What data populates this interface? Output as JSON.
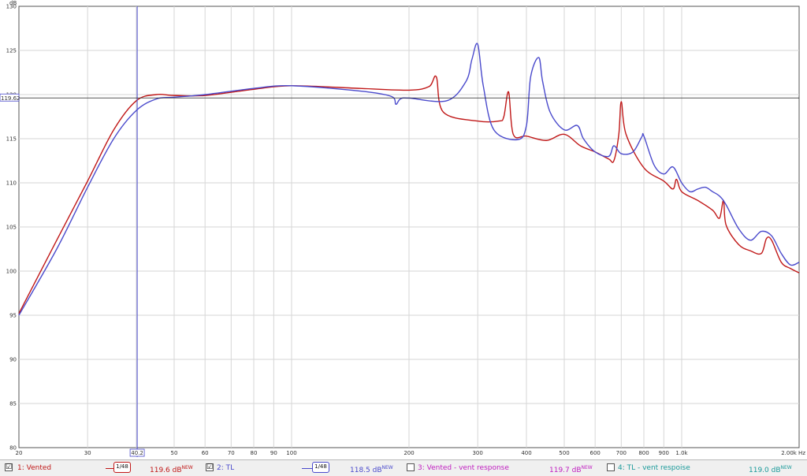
{
  "chart_data": {
    "type": "line",
    "title": "",
    "xlabel": "",
    "ylabel": "dB",
    "x_scale": "log",
    "xlim": [
      20,
      2000
    ],
    "ylim": [
      80,
      130
    ],
    "grid": true,
    "x_ticks": [
      {
        "v": 20,
        "label": "20"
      },
      {
        "v": 30,
        "label": "30"
      },
      {
        "v": 40,
        "label": ""
      },
      {
        "v": 50,
        "label": "50"
      },
      {
        "v": 60,
        "label": "60"
      },
      {
        "v": 70,
        "label": "70"
      },
      {
        "v": 80,
        "label": "80"
      },
      {
        "v": 90,
        "label": "90"
      },
      {
        "v": 100,
        "label": "100"
      },
      {
        "v": 200,
        "label": "200"
      },
      {
        "v": 300,
        "label": "300"
      },
      {
        "v": 400,
        "label": "400"
      },
      {
        "v": 500,
        "label": "500"
      },
      {
        "v": 600,
        "label": "600"
      },
      {
        "v": 700,
        "label": "700"
      },
      {
        "v": 800,
        "label": "800"
      },
      {
        "v": 900,
        "label": "900"
      },
      {
        "v": 1000,
        "label": "1.0k"
      },
      {
        "v": 2000,
        "label": "2.00k Hz"
      }
    ],
    "y_ticks": [
      80,
      85,
      90,
      95,
      100,
      105,
      110,
      115,
      120,
      125,
      130
    ],
    "cursor": {
      "x": 40.2,
      "x_label": "40.2",
      "y": 119.62,
      "y_label": "119.62"
    },
    "series": [
      {
        "name": "1: Vented",
        "color": "#c01818",
        "x": [
          20,
          25,
          30,
          35,
          40,
          45,
          50,
          60,
          80,
          100,
          150,
          200,
          225,
          235,
          245,
          300,
          340,
          350,
          360,
          370,
          400,
          450,
          500,
          550,
          600,
          650,
          670,
          690,
          700,
          720,
          800,
          900,
          950,
          970,
          1000,
          1100,
          1200,
          1250,
          1280,
          1300,
          1400,
          1500,
          1600,
          1650,
          1700,
          1800,
          1900,
          2000
        ],
        "y": [
          95.2,
          103.5,
          110.2,
          116.0,
          119.3,
          120.0,
          119.9,
          119.9,
          120.6,
          121.0,
          120.7,
          120.5,
          120.9,
          122.0,
          118.0,
          117.0,
          117.0,
          117.5,
          120.3,
          115.5,
          115.3,
          114.8,
          115.5,
          114.2,
          113.5,
          112.7,
          112.5,
          115.5,
          119.2,
          115.5,
          111.7,
          110.2,
          109.3,
          110.4,
          109.0,
          108.0,
          106.9,
          106.0,
          108.0,
          105.2,
          103.0,
          102.3,
          102.0,
          103.7,
          103.5,
          101.0,
          100.3,
          99.8
        ]
      },
      {
        "name": "2: TL",
        "color": "#4a4acc",
        "x": [
          20,
          25,
          30,
          35,
          40,
          45,
          50,
          60,
          80,
          100,
          150,
          180,
          185,
          190,
          200,
          250,
          280,
          290,
          300,
          310,
          330,
          380,
          400,
          410,
          430,
          440,
          460,
          500,
          540,
          560,
          600,
          650,
          670,
          700,
          750,
          790,
          800,
          850,
          900,
          950,
          1000,
          1050,
          1100,
          1150,
          1200,
          1250,
          1300,
          1400,
          1500,
          1600,
          1700,
          1800,
          1900,
          2000
        ],
        "y": [
          95.0,
          102.5,
          109.5,
          115.0,
          118.2,
          119.5,
          119.7,
          120.0,
          120.7,
          121.0,
          120.4,
          119.8,
          118.9,
          119.5,
          119.6,
          119.3,
          121.5,
          124.0,
          125.7,
          121.0,
          116.0,
          114.9,
          116.5,
          122.0,
          124.2,
          121.5,
          118.0,
          116.0,
          116.5,
          115.0,
          113.5,
          113.0,
          114.2,
          113.3,
          113.5,
          115.2,
          115.3,
          112.0,
          111.0,
          111.8,
          110.0,
          109.0,
          109.3,
          109.5,
          109.0,
          108.5,
          107.5,
          104.8,
          103.5,
          104.5,
          104.0,
          102.0,
          100.7,
          101.0
        ]
      }
    ]
  },
  "legend": [
    {
      "check": "☑",
      "name": "1: Vented",
      "smoothing": "1/48",
      "value": "119.6 dB",
      "badge": "NEW",
      "color": "#c01818",
      "checked": true
    },
    {
      "check": "☑",
      "name": "2: TL",
      "smoothing": "1/48",
      "value": "118.5 dB",
      "badge": "NEW",
      "color": "#4a4acc",
      "checked": true
    },
    {
      "check": "",
      "name": "3: Vented - vent response",
      "smoothing": "",
      "value": "119.7 dB",
      "badge": "NEW",
      "color": "#c020c0",
      "checked": false
    },
    {
      "check": "",
      "name": "4: TL - vent respoise",
      "smoothing": "",
      "value": "119.0 dB",
      "badge": "NEW",
      "color": "#1a9a9a",
      "checked": false
    }
  ]
}
